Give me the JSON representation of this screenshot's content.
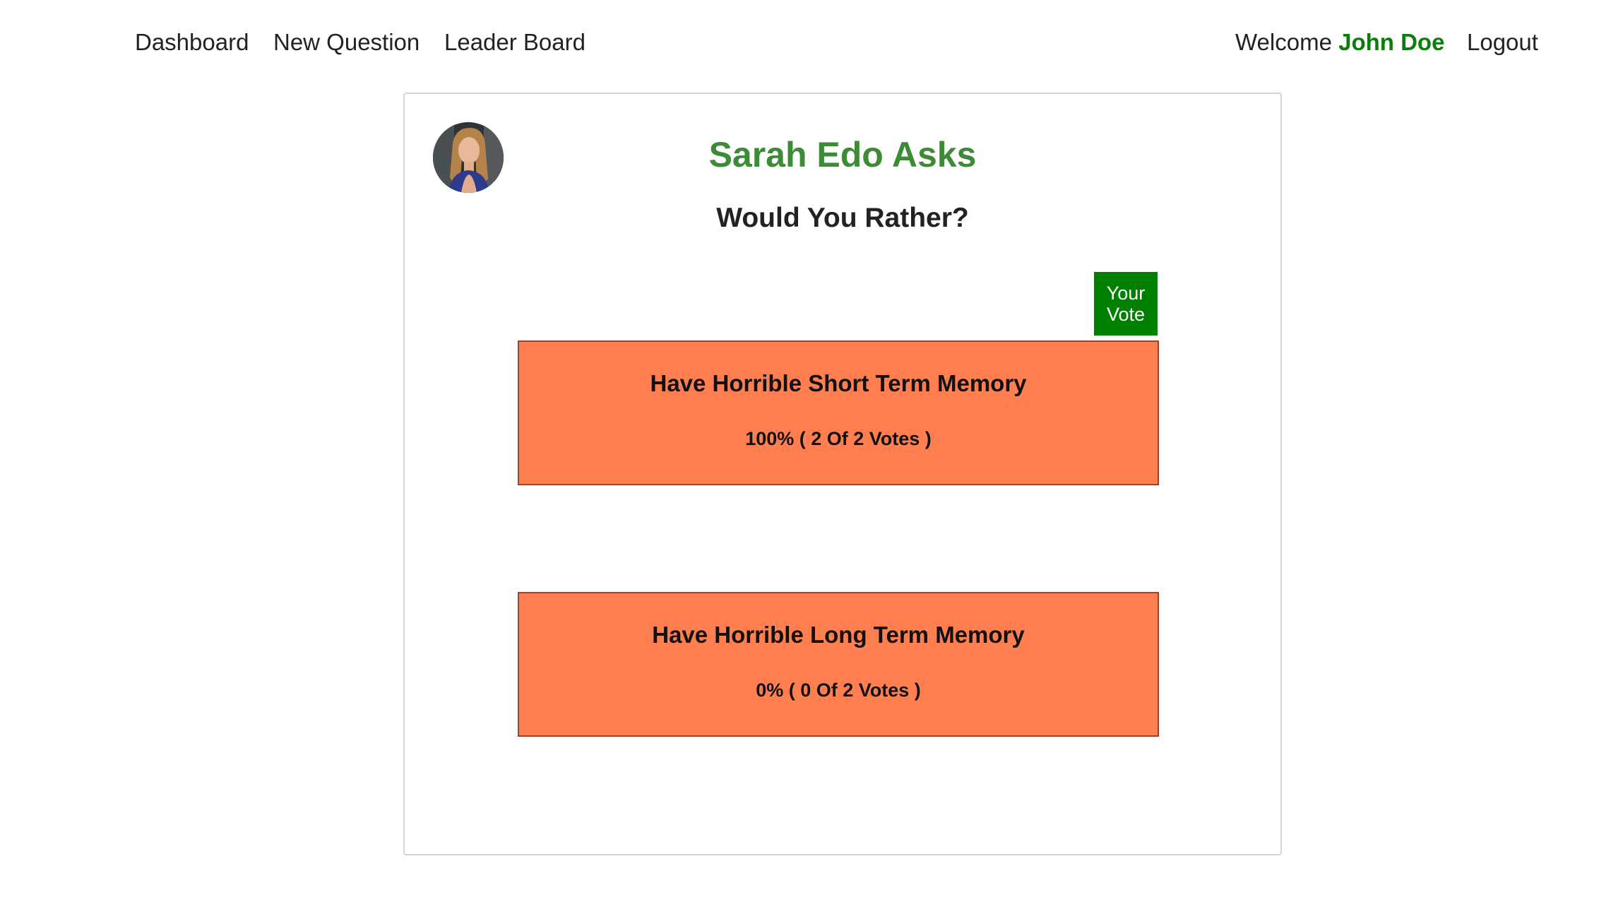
{
  "nav": {
    "dashboard": "Dashboard",
    "new_question": "New Question",
    "leader_board": "Leader Board",
    "welcome_label": "Welcome",
    "user_name": "John Doe",
    "logout": "Logout"
  },
  "card": {
    "avatar_icon": "user-avatar-photo",
    "author_title": "Sarah Edo Asks",
    "question_title": "Would You Rather?",
    "vote_badge": {
      "line1": "Your",
      "line2": "Vote"
    },
    "options": [
      {
        "text": "Have Horrible Short Term Memory",
        "result": "100% ( 2 Of 2 Votes )",
        "percent": 100,
        "votes": 2,
        "total_votes": 2,
        "is_user_vote": true
      },
      {
        "text": "Have Horrible Long Term Memory",
        "result": "0% ( 0 Of 2 Votes )",
        "percent": 0,
        "votes": 0,
        "total_votes": 2,
        "is_user_vote": false
      }
    ]
  },
  "colors": {
    "accent_green": "#3d8b37",
    "user_name_green": "#0a7d0a",
    "vote_badge_bg": "#008000",
    "option_bg": "#ff7f50"
  }
}
